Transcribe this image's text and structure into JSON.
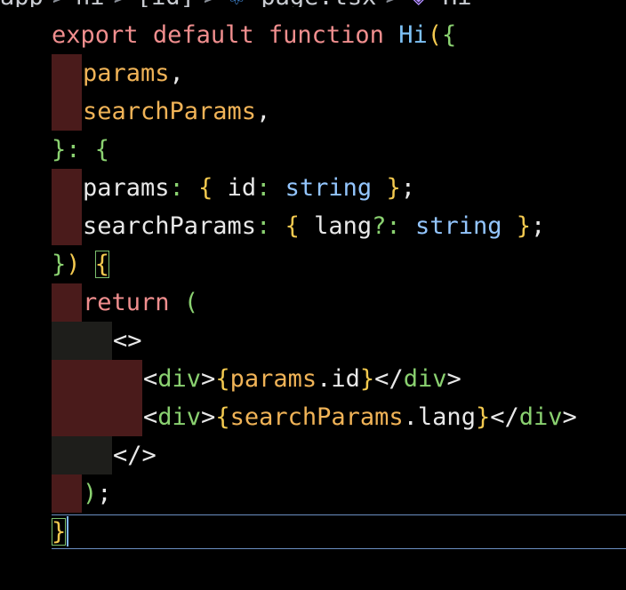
{
  "breadcrumb": {
    "items": [
      "app",
      "hi",
      "[id]",
      "page.tsx",
      "Hi"
    ],
    "separator": ">",
    "icons": [
      "react-icon",
      "cube-icon"
    ]
  },
  "editor": {
    "lines": [
      {
        "tokens": [
          {
            "t": "export",
            "c": "kw"
          },
          {
            "t": " ",
            "c": "plain"
          },
          {
            "t": "default",
            "c": "kw"
          },
          {
            "t": " ",
            "c": "plain"
          },
          {
            "t": "function",
            "c": "kw"
          },
          {
            "t": " ",
            "c": "plain"
          },
          {
            "t": "Hi",
            "c": "fn"
          },
          {
            "t": "(",
            "c": "bracket-y"
          },
          {
            "t": "{",
            "c": "bracket-g"
          }
        ]
      },
      {
        "tokens": [
          {
            "t": "params",
            "c": "prop"
          },
          {
            "t": ",",
            "c": "plain"
          }
        ]
      },
      {
        "tokens": [
          {
            "t": "searchParams",
            "c": "prop"
          },
          {
            "t": ",",
            "c": "plain"
          }
        ]
      },
      {
        "tokens": [
          {
            "t": "}",
            "c": "bracket-g"
          },
          {
            "t": ":",
            "c": "punct"
          },
          {
            "t": " ",
            "c": "plain"
          },
          {
            "t": "{",
            "c": "bracket-g"
          }
        ]
      },
      {
        "tokens": [
          {
            "t": "params",
            "c": "plain"
          },
          {
            "t": ":",
            "c": "punct"
          },
          {
            "t": " ",
            "c": "plain"
          },
          {
            "t": "{",
            "c": "bracket-y"
          },
          {
            "t": " id",
            "c": "plain"
          },
          {
            "t": ":",
            "c": "punct"
          },
          {
            "t": " ",
            "c": "plain"
          },
          {
            "t": "string",
            "c": "type"
          },
          {
            "t": " ",
            "c": "plain"
          },
          {
            "t": "}",
            "c": "bracket-y"
          },
          {
            "t": ";",
            "c": "plain"
          }
        ]
      },
      {
        "tokens": [
          {
            "t": "searchParams",
            "c": "plain"
          },
          {
            "t": ":",
            "c": "punct"
          },
          {
            "t": " ",
            "c": "plain"
          },
          {
            "t": "{",
            "c": "bracket-y"
          },
          {
            "t": " lang",
            "c": "plain"
          },
          {
            "t": "?:",
            "c": "punct"
          },
          {
            "t": " ",
            "c": "plain"
          },
          {
            "t": "string",
            "c": "type"
          },
          {
            "t": " ",
            "c": "plain"
          },
          {
            "t": "}",
            "c": "bracket-y"
          },
          {
            "t": ";",
            "c": "plain"
          }
        ]
      },
      {
        "tokens": [
          {
            "t": "}",
            "c": "bracket-g"
          },
          {
            "t": ")",
            "c": "bracket-y"
          },
          {
            "t": " ",
            "c": "plain"
          },
          {
            "t": "{",
            "c": "bracket-y match"
          }
        ]
      },
      {
        "tokens": [
          {
            "t": "return",
            "c": "kw"
          },
          {
            "t": " ",
            "c": "plain"
          },
          {
            "t": "(",
            "c": "bracket-g"
          }
        ]
      },
      {
        "tokens": [
          {
            "t": "<>",
            "c": "plain"
          }
        ]
      },
      {
        "tokens": [
          {
            "t": "<",
            "c": "plain"
          },
          {
            "t": "div",
            "c": "tag"
          },
          {
            "t": ">",
            "c": "plain"
          },
          {
            "t": "{",
            "c": "bracket-y"
          },
          {
            "t": "params",
            "c": "prop"
          },
          {
            "t": ".",
            "c": "plain"
          },
          {
            "t": "id",
            "c": "plain"
          },
          {
            "t": "}",
            "c": "bracket-y"
          },
          {
            "t": "</",
            "c": "plain"
          },
          {
            "t": "div",
            "c": "tag"
          },
          {
            "t": ">",
            "c": "plain"
          }
        ]
      },
      {
        "tokens": [
          {
            "t": "<",
            "c": "plain"
          },
          {
            "t": "div",
            "c": "tag"
          },
          {
            "t": ">",
            "c": "plain"
          },
          {
            "t": "{",
            "c": "bracket-y"
          },
          {
            "t": "searchParams",
            "c": "prop"
          },
          {
            "t": ".",
            "c": "plain"
          },
          {
            "t": "lang",
            "c": "plain"
          },
          {
            "t": "}",
            "c": "bracket-y"
          },
          {
            "t": "</",
            "c": "plain"
          },
          {
            "t": "div",
            "c": "tag"
          },
          {
            "t": ">",
            "c": "plain"
          }
        ]
      },
      {
        "tokens": [
          {
            "t": "</>",
            "c": "plain"
          }
        ]
      },
      {
        "tokens": [
          {
            "t": ")",
            "c": "bracket-g"
          },
          {
            "t": ";",
            "c": "plain"
          }
        ]
      },
      {
        "tokens": [
          {
            "t": "}",
            "c": "bracket-y match"
          }
        ]
      }
    ]
  },
  "colors": {
    "background": "#000000",
    "keyword": "#f08e8e",
    "function": "#7ec2f7",
    "property": "#f0b357",
    "type": "#93c5fd",
    "indent_error": "#4a1b1b",
    "current_line_border": "#6b8fc2"
  }
}
